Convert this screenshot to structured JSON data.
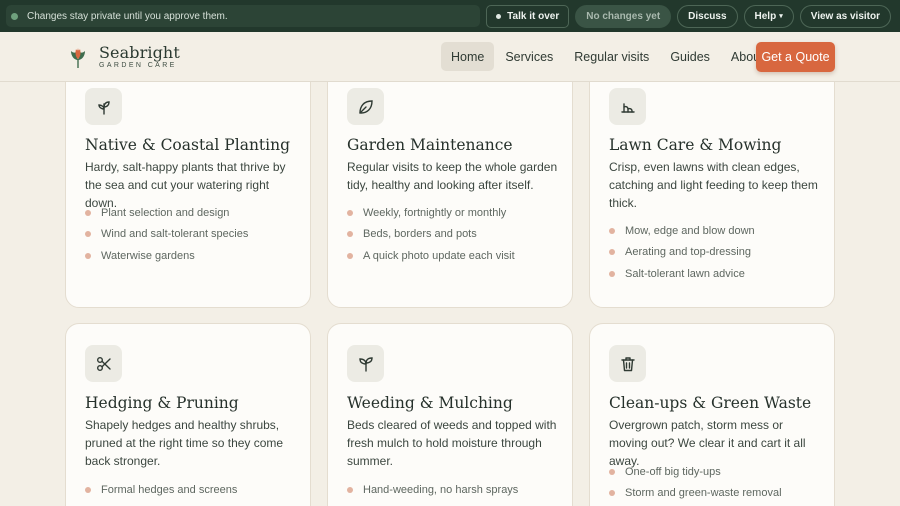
{
  "preview_bar": {
    "notice": "Changes stay private until you approve them.",
    "talk_label": "Talk it over",
    "status_label": "No changes yet",
    "discuss_label": "Discuss",
    "help_label": "Help",
    "visitor_label": "View as visitor"
  },
  "header": {
    "brand_name": "Seabright",
    "brand_sub": "GARDEN CARE",
    "nav": [
      "Home",
      "Services",
      "Regular visits",
      "Guides",
      "About"
    ],
    "active_nav": "Home",
    "cta_label": "Get a Quote"
  },
  "services": [
    {
      "icon": "sprout-icon",
      "title": "Native & Coastal Planting",
      "description": "Hardy, salt-happy plants that thrive by the sea and cut your watering right down.",
      "items": [
        "Plant selection and design",
        "Wind and salt-tolerant species",
        "Waterwise gardens"
      ]
    },
    {
      "icon": "leaf-icon",
      "title": "Garden Maintenance",
      "description": "Regular visits to keep the whole garden tidy, healthy and looking after itself.",
      "items": [
        "Weekly, fortnightly or monthly",
        "Beds, borders and pots",
        "A quick photo update each visit"
      ]
    },
    {
      "icon": "grass-icon",
      "title": "Lawn Care & Mowing",
      "description": "Crisp, even lawns with clean edges, catching and light feeding to keep them thick.",
      "items": [
        "Mow, edge and blow down",
        "Aerating and top-dressing",
        "Salt-tolerant lawn advice"
      ]
    },
    {
      "icon": "scissors-icon",
      "title": "Hedging & Pruning",
      "description": "Shapely hedges and healthy shrubs, pruned at the right time so they come back stronger.",
      "items": [
        "Formal hedges and screens"
      ]
    },
    {
      "icon": "seedling-icon",
      "title": "Weeding & Mulching",
      "description": "Beds cleared of weeds and topped with fresh mulch to hold moisture through summer.",
      "items": [
        "Hand-weeding, no harsh sprays"
      ]
    },
    {
      "icon": "bin-icon",
      "title": "Clean-ups & Green Waste",
      "description": "Overgrown patch, storm mess or moving out? We clear it and cart it all away.",
      "items": [
        "One-off big tidy-ups",
        "Storm and green-waste removal"
      ]
    }
  ],
  "colors": {
    "preview_bar": "#22382c",
    "accent": "#d8673f",
    "page_bg": "#f3efe6",
    "bullet": "#e2b3a0"
  }
}
